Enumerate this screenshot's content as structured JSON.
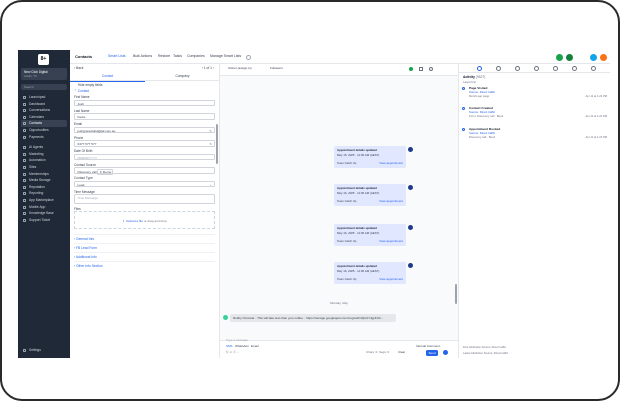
{
  "sidebar": {
    "logo": "8+",
    "account_name": "New Club Digital",
    "account_sub": "Austin, TX",
    "search": "Search",
    "items": [
      {
        "label": "Launchpad"
      },
      {
        "label": "Dashboard"
      },
      {
        "label": "Conversations"
      },
      {
        "label": "Calendars"
      },
      {
        "label": "Contacts",
        "active": true
      },
      {
        "label": "Opportunities"
      },
      {
        "label": "Payments"
      },
      {
        "label": "AI Agents"
      },
      {
        "label": "Marketing"
      },
      {
        "label": "Automation"
      },
      {
        "label": "Sites"
      },
      {
        "label": "Memberships"
      },
      {
        "label": "Media Storage"
      },
      {
        "label": "Reputation"
      },
      {
        "label": "Reporting"
      },
      {
        "label": "App Marketplace"
      },
      {
        "label": "Mobile App"
      },
      {
        "label": "Knowledge Base"
      },
      {
        "label": "Support Ticket"
      }
    ],
    "settings": "Settings"
  },
  "topbar": {
    "title": "Contacts",
    "tabs": [
      "Smart Lists",
      "Bulk Actions",
      "Restore",
      "Tasks",
      "Companies",
      "Manage Smart Lists"
    ]
  },
  "contact": {
    "back": "Back",
    "pager": "1 of 1",
    "subtabs": [
      "Contact",
      "Company"
    ],
    "hide_empty": "Hide empty fields",
    "section": "Contact",
    "fields": [
      {
        "label": "First Name",
        "value": "Josh"
      },
      {
        "label": "Last Name",
        "value": "Kiebe"
      },
      {
        "label": "Email",
        "value": "joshgnewclubdigital.com.au"
      },
      {
        "label": "Phone",
        "value": "0477 577 577"
      },
      {
        "label": "Date Of Birth",
        "value": "MM/DD/YYYY"
      },
      {
        "label": "Contact Source",
        "value": "Discovery call",
        "chip": "Demo"
      },
      {
        "label": "Contact Type",
        "value": "Lead"
      },
      {
        "label": "Time Message",
        "value": "Time Message"
      }
    ],
    "files_label": "Files",
    "upload_link": "Upload a file",
    "upload_rest": " or drag and drop",
    "collapsed": [
      "General Info",
      "FB Lead Form",
      "Additional Info",
      "Other Info Section"
    ]
  },
  "conversation": {
    "header": "Owner (assign to)",
    "followers": "Followers",
    "appointments": [
      {
        "title": "Appointment details updated",
        "date": "May 15, 2025",
        "time": "11:00 AM (AEST)",
        "team": "Team Catch Up"
      },
      {
        "title": "Appointment details updated",
        "date": "May 16, 2025",
        "time": "11:00 AM (AEST)",
        "team": "Team Catch Up"
      },
      {
        "title": "Appointment details updated",
        "date": "May 16, 2025",
        "time": "11:00 AM (AEST)",
        "team": "Team Catch Up"
      },
      {
        "title": "Appointment details updated",
        "date": "May 16, 2025",
        "time": "11:00 AM (AEST)",
        "team": "Team Catch Up"
      }
    ],
    "view_label": "View appointment",
    "date_sep": "Monday, May",
    "message": "Robby Chocular · This will take less than your coffee... https://storage.googleapis.com/msgsndr/4QUA7JgpKIxh...",
    "channels": [
      "SMS",
      "WhatsApp",
      "Email"
    ],
    "internal_comment": "Internal Comment",
    "from_label": "From:",
    "from_value": "+61 477 577 577",
    "to_label": "To:",
    "to_value": "+61 477 577 577",
    "placeholder": "Type a message",
    "counter": "Chars: 0, Segs: 0",
    "clear": "Clear",
    "send": "Send"
  },
  "activity": {
    "title": "Activity",
    "count": "(9527)",
    "filter": "Latest first",
    "events": [
      {
        "title": "Page Visited",
        "link": "Source: Direct traffic",
        "meta": "Month ago page",
        "date": "Apr 11 at 1:24 PM"
      },
      {
        "title": "Contact Created",
        "link": "Source: Direct traffic",
        "meta": "Form: Discovery call · Book",
        "date": "Apr 11 at 1:24 PM"
      },
      {
        "title": "Appointment Booked",
        "link": "Source: Direct traffic",
        "meta": "Discovery call · Book",
        "date": "Apr 11 at 1:24 PM"
      }
    ],
    "footer1": "First Attribution Source: Direct traffic",
    "footer2": "Latest Attribution Source: Direct traffic"
  }
}
